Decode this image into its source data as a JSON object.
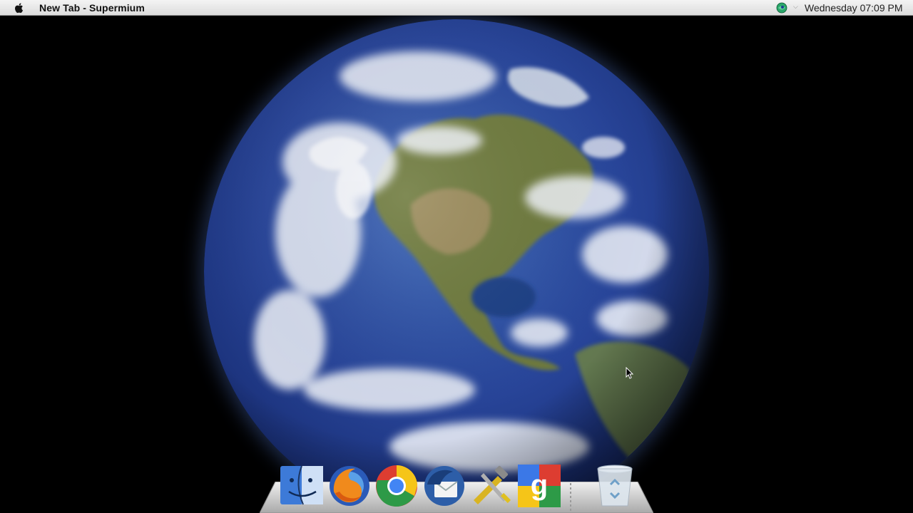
{
  "menubar": {
    "apple_icon": "apple-logo-icon",
    "window_title": "New Tab - Supermium",
    "tray_icon": "network-globe-icon",
    "clock": "Wednesday 07:09 PM"
  },
  "desktop": {
    "wallpaper": "earth-globe"
  },
  "dock": {
    "items": [
      {
        "name": "Finder",
        "icon": "finder-icon"
      },
      {
        "name": "Firefox",
        "icon": "firefox-icon"
      },
      {
        "name": "Chrome",
        "icon": "chrome-icon"
      },
      {
        "name": "Thunderbird",
        "icon": "thunderbird-icon"
      },
      {
        "name": "System Utilities",
        "icon": "utilities-tools-icon"
      },
      {
        "name": "Google",
        "icon": "google-icon"
      },
      {
        "name": "Recycle Bin",
        "icon": "trash-icon"
      }
    ]
  },
  "colors": {
    "menubar_bg": "#e6e6e6",
    "desktop_bg": "#000000",
    "ocean": "#28459a"
  }
}
